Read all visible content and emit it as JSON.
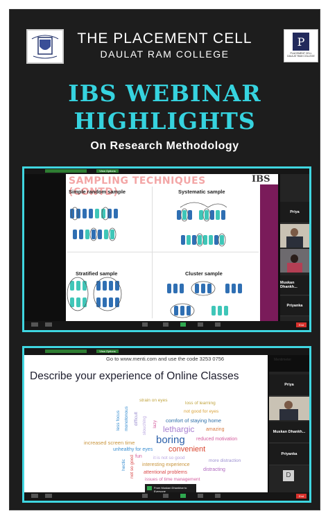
{
  "header": {
    "left_logo_text": "DAULAT RAM COLLEGE",
    "right_logo_text": "PLACEMENT CELL DAULAT RAM COLLEGE",
    "title_line1": "THE PLACEMENT CELL",
    "title_line2": "DAULAT RAM COLLEGE",
    "headline_line1": "IBS WEBINAR",
    "headline_line2": "HIGHLIGHTS",
    "subtitle": "On Research Methodology"
  },
  "shot1": {
    "view_options": "View Options",
    "slide_title": "SAMPLING TECHNIQUES (CONTD)",
    "brand": "IBS",
    "quadrants": [
      "Simple random sample",
      "Systematic sample",
      "Stratified sample",
      "Cluster sample"
    ],
    "participants": [
      "Priya",
      "",
      "",
      "Muskan Dhankh...",
      "Priyanka"
    ],
    "end_button": "End"
  },
  "shot2": {
    "view_options": "View Options",
    "instruction": "Go to www.menti.com and use the code 3253 0756",
    "brand": "Mentimeter",
    "question": "Describe your experience of Online Classes",
    "words": [
      "strain on eyes",
      "loss of learning",
      "not good for eyes",
      "less focus",
      "monotonous",
      "difficult",
      "slouching",
      "lazy",
      "comfort of staying home",
      "lethargic",
      "amazing",
      "increased screen time",
      "boring",
      "reduced motivation",
      "unhealthy for eyes",
      "convenient",
      "fun",
      "it is not so good",
      "more distraction",
      "hectic",
      "not so good",
      "interesting experience",
      "attentional problems",
      "distracting",
      "issues of time management"
    ],
    "participants": [
      "Priya",
      "",
      "Muskan Dhankh...",
      "Priyanka",
      "D"
    ],
    "chat_from": "From Muskan Dhankhar to Everyone",
    "chat_msg": "mam unable to",
    "end_button": "End"
  },
  "colors": {
    "accent": "#36d3df",
    "frame": "#3fd6e0",
    "background": "#1d1d1d",
    "slide_title": "#f3a6a6"
  }
}
